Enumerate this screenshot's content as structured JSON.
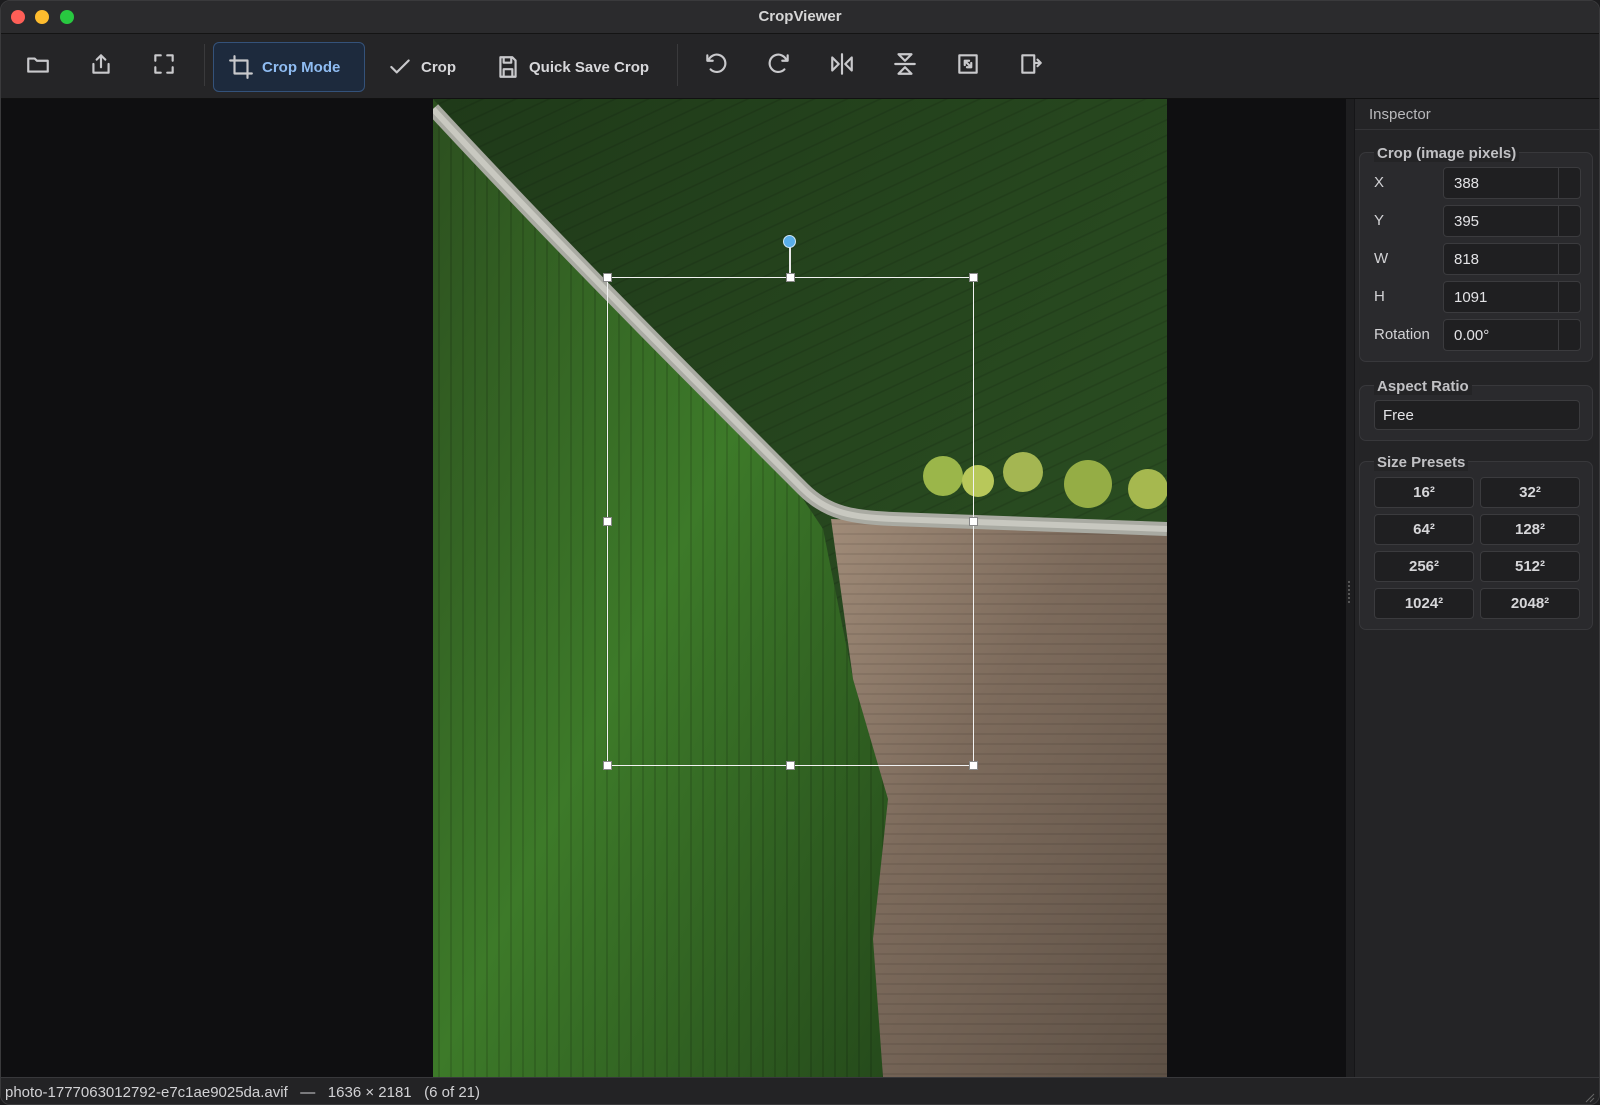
{
  "window": {
    "title": "CropViewer"
  },
  "toolbar": {
    "open_icon": "folder-icon",
    "export_icon": "share-icon",
    "fullscreen_icon": "fullscreen-icon",
    "crop_mode_label": "Crop Mode",
    "crop_label": "Crop",
    "quick_save_label": "Quick Save Crop",
    "icons_right": [
      "rotate-left-icon",
      "rotate-right-icon",
      "flip-horizontal-icon",
      "flip-vertical-icon",
      "resize-icon",
      "canvas-size-icon"
    ]
  },
  "inspector": {
    "title": "Inspector",
    "crop_group": {
      "title": "Crop (image pixels)",
      "fields": [
        {
          "label": "X",
          "value": "388"
        },
        {
          "label": "Y",
          "value": "395"
        },
        {
          "label": "W",
          "value": "818"
        },
        {
          "label": "H",
          "value": "1091"
        },
        {
          "label": "Rotation",
          "value": "0.00°"
        }
      ]
    },
    "aspect_group": {
      "title": "Aspect Ratio",
      "value": "Free"
    },
    "presets_group": {
      "title": "Size Presets",
      "presets": [
        "16²",
        "32²",
        "64²",
        "128²",
        "256²",
        "512²",
        "1024²",
        "2048²"
      ]
    }
  },
  "status": {
    "filename": "photo-1777063012792-e7c1ae9025da.avif",
    "separator": "—",
    "dimensions": "1636 × 2181",
    "position": "(6 of 21)"
  },
  "colors": {
    "accent": "#8fbcf2",
    "rotation_handle": "#5aaee8",
    "field_green": "#2f5a22",
    "soil": "#7a6a5b"
  }
}
